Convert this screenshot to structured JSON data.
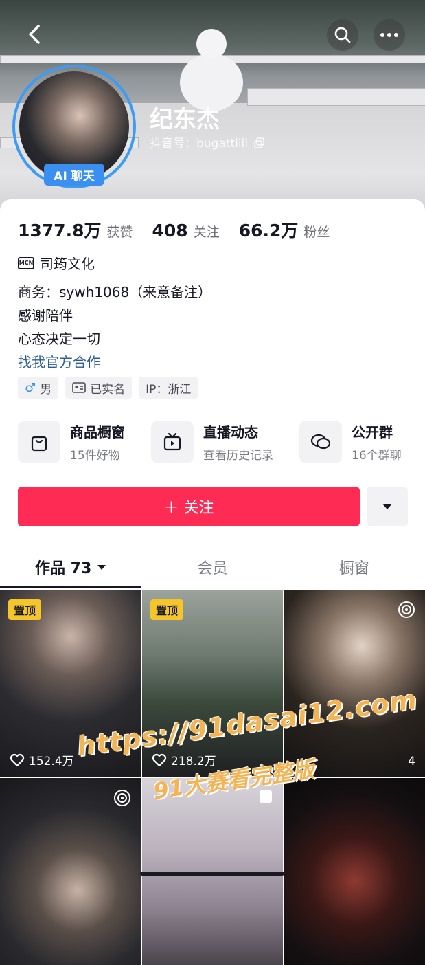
{
  "profile": {
    "name": "纪东杰",
    "douyin_id": "抖音号：bugattiiii",
    "ai_badge": "AI 聊天"
  },
  "stats": [
    {
      "num": "1377.8万",
      "label": "获赞"
    },
    {
      "num": "408",
      "label": "关注"
    },
    {
      "num": "66.2万",
      "label": "粉丝"
    }
  ],
  "mcn": {
    "badge": "MCN",
    "name": "司筠文化"
  },
  "bio": {
    "line1": "商务：sywh1068（来意备注）",
    "line2": "感谢陪伴",
    "line3": "心态决定一切",
    "link": "找我官方合作"
  },
  "tags": {
    "gender": "男",
    "verified": "已实名",
    "ip": "IP：浙江"
  },
  "services": [
    {
      "title": "商品橱窗",
      "sub": "15件好物",
      "icon": "bag-icon"
    },
    {
      "title": "直播动态",
      "sub": "查看历史记录",
      "icon": "tv-icon"
    },
    {
      "title": "公开群",
      "sub": "16个群聊",
      "icon": "chat-icon"
    }
  ],
  "actions": {
    "follow": "＋ 关注"
  },
  "tabs": {
    "works": "作品 73",
    "member": "会员",
    "showcase": "橱窗"
  },
  "videos": [
    {
      "pinned": "置顶",
      "likes": "152.4万"
    },
    {
      "pinned": "置顶",
      "likes": "218.2万"
    },
    {
      "likes": "4"
    }
  ],
  "watermark": {
    "line1": "https://91dasai12.com",
    "line2": "91大赛看完整版"
  },
  "colors": {
    "accent": "#fe2c55",
    "ai_blue": "#3b8ff0",
    "pin_yellow": "#f5c52c"
  }
}
